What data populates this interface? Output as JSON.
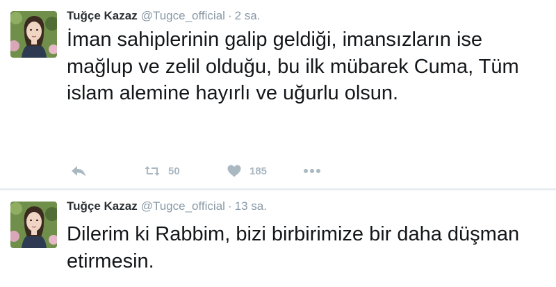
{
  "tweets": [
    {
      "author_name": "Tuğçe Kazaz",
      "handle": "@Tugce_official",
      "separator": "·",
      "time": "2 sa.",
      "text": "İman sahiplerinin galip geldiği, imansızların ise mağlup ve zelil olduğu, bu ilk mübarek Cuma, Tüm islam alemine hayırlı ve uğurlu olsun.",
      "retweet_count": "50",
      "like_count": "185"
    },
    {
      "author_name": "Tuğçe Kazaz",
      "handle": "@Tugce_official",
      "separator": "·",
      "time": "13 sa.",
      "text": "Dilerim ki Rabbim, bizi birbirimize bir daha düşman etirmesin."
    }
  ],
  "icons": {
    "reply": "reply-icon",
    "retweet": "retweet-icon",
    "like": "heart-icon",
    "more": "more-dots-icon",
    "avatar": "profile-photo"
  },
  "colors": {
    "feed_background": "#e6ecf0",
    "card_background": "#ffffff",
    "name": "#292f33",
    "meta": "#8899a6",
    "text": "#14171a",
    "action_icon": "#aab8c2"
  }
}
